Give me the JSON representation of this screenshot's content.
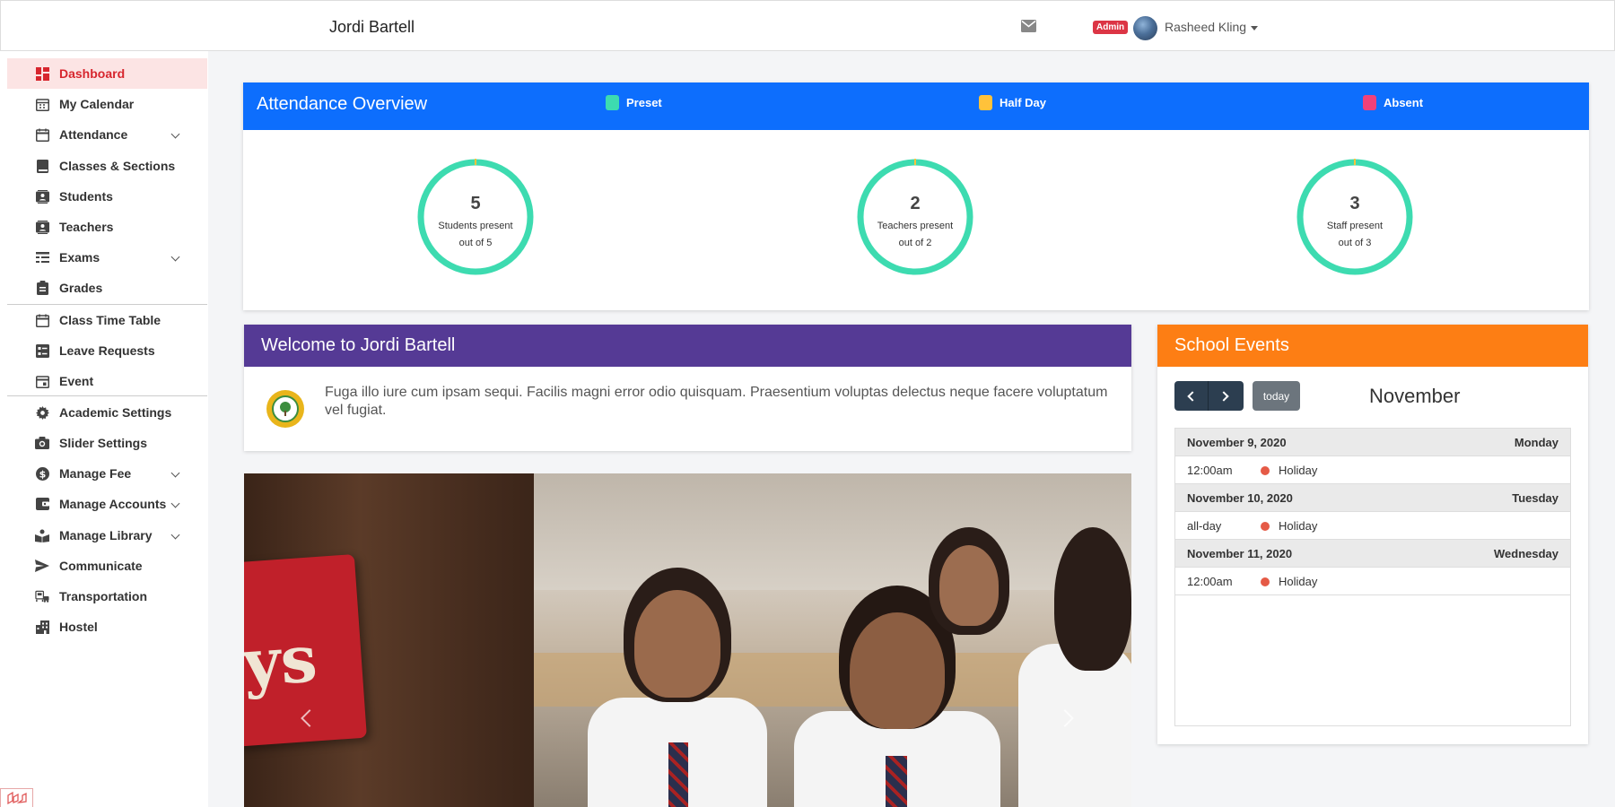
{
  "header": {
    "school_name": "Jordi Bartell",
    "role_badge": "Admin",
    "user_name": "Rasheed Kling"
  },
  "sidebar": {
    "items": [
      {
        "label": "Dashboard",
        "icon": "dashboard-icon",
        "active": true
      },
      {
        "label": "My Calendar",
        "icon": "calendar-icon"
      },
      {
        "label": "Attendance",
        "icon": "calendar-icon",
        "expandable": true
      },
      {
        "label": "Classes & Sections",
        "icon": "book-icon"
      },
      {
        "label": "Students",
        "icon": "contact-card-icon"
      },
      {
        "label": "Teachers",
        "icon": "contact-card-icon"
      },
      {
        "label": "Exams",
        "icon": "list-icon",
        "expandable": true
      },
      {
        "label": "Grades",
        "icon": "clipboard-icon"
      },
      {
        "label": "Class Time Table",
        "icon": "calendar-icon"
      },
      {
        "label": "Leave Requests",
        "icon": "checklist-icon"
      },
      {
        "label": "Event",
        "icon": "calendar-event-icon"
      },
      {
        "label": "Academic Settings",
        "icon": "gear-icon"
      },
      {
        "label": "Slider Settings",
        "icon": "camera-icon"
      },
      {
        "label": "Manage Fee",
        "icon": "dollar-icon",
        "expandable": true
      },
      {
        "label": "Manage Accounts",
        "icon": "wallet-icon",
        "expandable": true
      },
      {
        "label": "Manage Library",
        "icon": "library-icon",
        "expandable": true
      },
      {
        "label": "Communicate",
        "icon": "send-icon"
      },
      {
        "label": "Transportation",
        "icon": "bus-icon"
      },
      {
        "label": "Hostel",
        "icon": "building-icon"
      }
    ]
  },
  "attendance": {
    "title": "Attendance Overview",
    "legend": [
      {
        "label": "Preset",
        "color": "#3ddbb0"
      },
      {
        "label": "Half Day",
        "color": "#ffc23a"
      },
      {
        "label": "Absent",
        "color": "#f0417a"
      }
    ],
    "stats": [
      {
        "value": "5",
        "caption": "Students present",
        "total": "out of 5",
        "present": 5,
        "of": 5
      },
      {
        "value": "2",
        "caption": "Teachers present",
        "total": "out of 2",
        "present": 2,
        "of": 2
      },
      {
        "value": "3",
        "caption": "Staff present",
        "total": "out of 3",
        "present": 3,
        "of": 3
      }
    ]
  },
  "welcome": {
    "title": "Welcome to Jordi Bartell",
    "text": "Fuga illo iure cum ipsam sequi. Facilis magni error odio quisquam. Praesentium voluptas delectus neque facere voluptatum vel fugiat."
  },
  "carousel": {
    "sign_text": "ys"
  },
  "events": {
    "title": "School Events",
    "today_label": "today",
    "month": "November",
    "days": [
      {
        "date": "November 9, 2020",
        "weekday": "Monday",
        "events": [
          {
            "time": "12:00am",
            "title": "Holiday"
          }
        ]
      },
      {
        "date": "November 10, 2020",
        "weekday": "Tuesday",
        "events": [
          {
            "time": "all-day",
            "title": "Holiday"
          }
        ]
      },
      {
        "date": "November 11, 2020",
        "weekday": "Wednesday",
        "events": [
          {
            "time": "12:00am",
            "title": "Holiday"
          }
        ]
      }
    ]
  },
  "colors": {
    "attendance_header": "#0d6efd",
    "welcome_header": "#553a95",
    "events_header": "#fd7e14",
    "active_nav_bg": "#fce4e4",
    "active_nav_text": "#d7262e"
  }
}
